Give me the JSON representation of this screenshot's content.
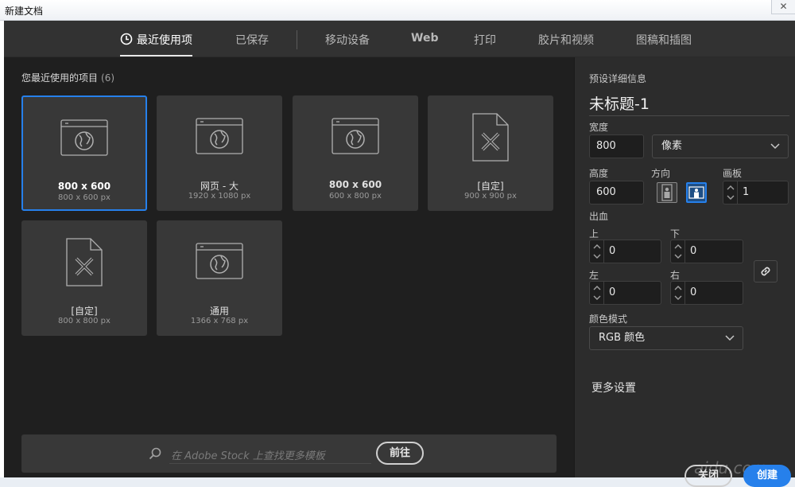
{
  "window": {
    "title": "新建文档",
    "close_glyph": "✕"
  },
  "tabs": [
    {
      "label": "最近使用项",
      "icon": "clock-icon",
      "active": true
    },
    {
      "label": "已保存"
    },
    {
      "label": "移动设备"
    },
    {
      "label": "Web"
    },
    {
      "label": "打印"
    },
    {
      "label": "胶片和视频"
    },
    {
      "label": "图稿和插图"
    }
  ],
  "recent": {
    "heading": "您最近使用的项目",
    "count": "(6)",
    "items": [
      {
        "name": "800 x 600",
        "size": "800 x 600 px",
        "icon": "web-globe-icon",
        "selected": true
      },
      {
        "name": "网页 - 大",
        "size": "1920 x 1080 px",
        "icon": "web-globe-icon"
      },
      {
        "name": "800 x 600",
        "size": "600 x 800 px",
        "icon": "web-globe-icon"
      },
      {
        "name": "[自定]",
        "size": "900 x 900 px",
        "icon": "custom-document-icon"
      },
      {
        "name": "[自定]",
        "size": "800 x 800 px",
        "icon": "custom-document-icon"
      },
      {
        "name": "通用",
        "size": "1366 x 768 px",
        "icon": "web-globe-icon"
      }
    ]
  },
  "stock": {
    "placeholder": "在 Adobe Stock 上查找更多模板",
    "go_label": "前往"
  },
  "details": {
    "heading": "预设详细信息",
    "doc_name": "未标题-1",
    "width_label": "宽度",
    "width_value": "800",
    "unit_value": "像素",
    "height_label": "高度",
    "height_value": "600",
    "orientation_label": "方向",
    "artboards_label": "画板",
    "artboards_value": "1",
    "bleed_label": "出血",
    "top_label": "上",
    "top_value": "0",
    "bottom_label": "下",
    "bottom_value": "0",
    "left_label": "左",
    "left_value": "0",
    "right_label": "右",
    "right_value": "0",
    "color_mode_label": "颜色模式",
    "color_mode_value": "RGB 颜色",
    "more_settings": "更多设置"
  },
  "watermark": "aidu.com",
  "buttons": {
    "close": "关闭",
    "create": "创建"
  },
  "colors": {
    "accent": "#2680eb",
    "panel_bg": "#1f1f1f",
    "card_bg": "#383838"
  }
}
